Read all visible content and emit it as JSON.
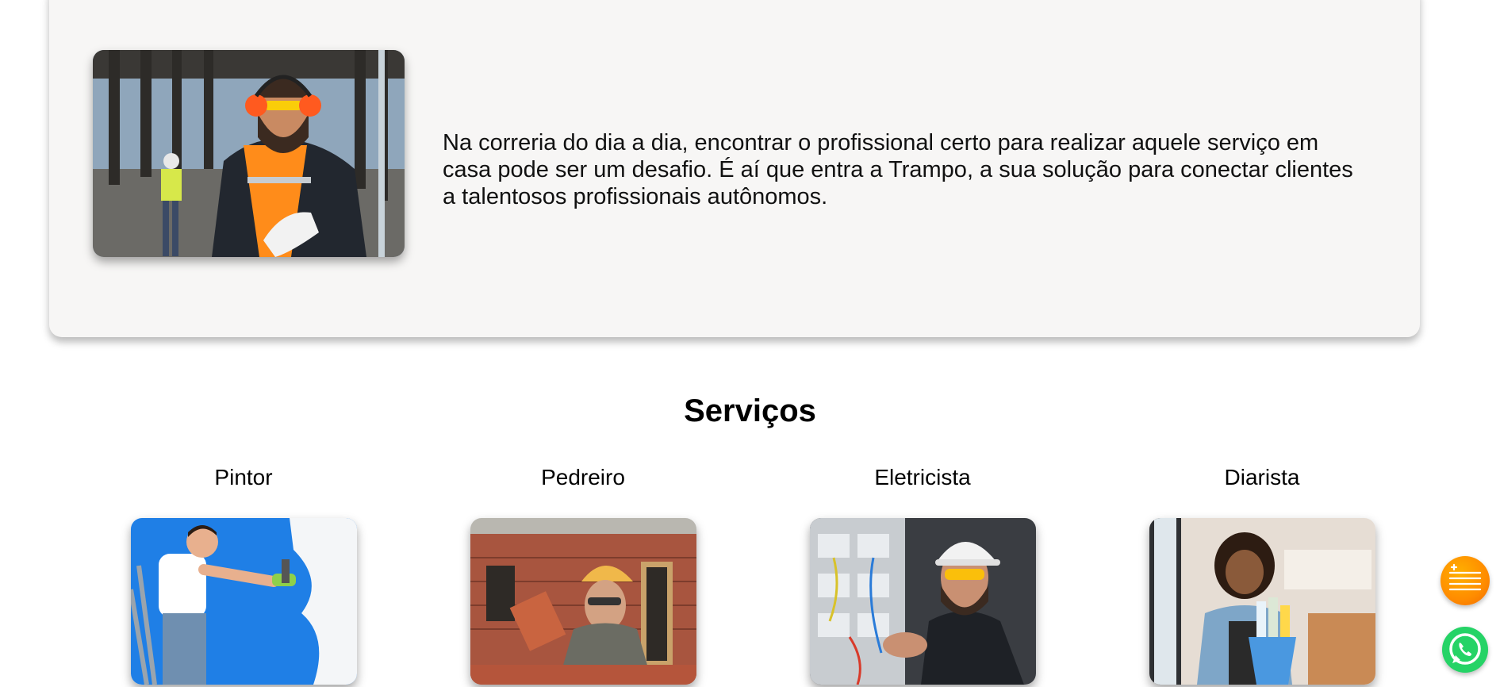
{
  "about": {
    "text": "Na correria do dia a dia, encontrar o profissional certo para realizar aquele serviço em casa pode ser um desafio. É aí que entra a Trampo, a sua solução para conectar clientes a talentosos profissionais autônomos."
  },
  "services": {
    "title": "Serviços",
    "items": [
      {
        "label": "Pintor"
      },
      {
        "label": "Pedreiro"
      },
      {
        "label": "Eletricista"
      },
      {
        "label": "Diarista"
      }
    ]
  },
  "floating": {
    "menu_icon": "menu-lines-icon",
    "chat_icon": "whatsapp-icon"
  },
  "colors": {
    "card_bg": "#f7f6f5",
    "accent_orange": "#ff8c00",
    "whatsapp_green": "#25d366"
  }
}
